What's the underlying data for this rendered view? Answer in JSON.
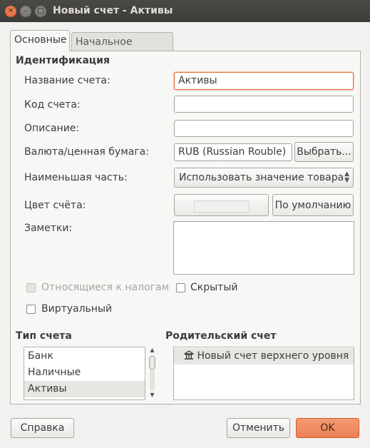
{
  "window": {
    "title": "Новый счет - Активы"
  },
  "tabs": [
    {
      "label": "Основные",
      "active": true
    },
    {
      "label": "Начальное сальдо",
      "active": false
    }
  ],
  "identification": {
    "heading": "Идентификация",
    "name_label": "Название счета:",
    "name_value": "Активы",
    "code_label": "Код счета:",
    "code_value": "",
    "description_label": "Описание:",
    "description_value": "",
    "currency_label": "Валюта/ценная бумага:",
    "currency_value": "RUB (Russian Rouble)",
    "select_button": "Выбрать...",
    "smallest_label": "Наименьшая часть:",
    "smallest_value": "Использовать значение товара",
    "color_label": "Цвет счёта:",
    "default_button": "По умолчанию",
    "notes_label": "Заметки:",
    "notes_value": ""
  },
  "checkboxes": {
    "tax_label": "Относящиеся к налогам",
    "tax_checked": false,
    "tax_enabled": false,
    "hidden_label": "Скрытый",
    "hidden_checked": false,
    "virtual_label": "Виртуальный",
    "virtual_checked": false
  },
  "account_type": {
    "heading": "Тип счета",
    "items": [
      "Банк",
      "Наличные",
      "Активы"
    ],
    "selected": "Активы"
  },
  "parent_account": {
    "heading": "Родительский счет",
    "items": [
      {
        "icon": "building-icon",
        "label": "Новый счет верхнего уровня"
      }
    ],
    "selected": "Новый счет верхнего уровня"
  },
  "footer": {
    "help_button": "Справка",
    "cancel_button": "Отменить",
    "ok_button": "OK"
  },
  "colors": {
    "accent": "#e86c3c",
    "ok_button": "#ee8057",
    "titlebar": "#3c3b37"
  }
}
